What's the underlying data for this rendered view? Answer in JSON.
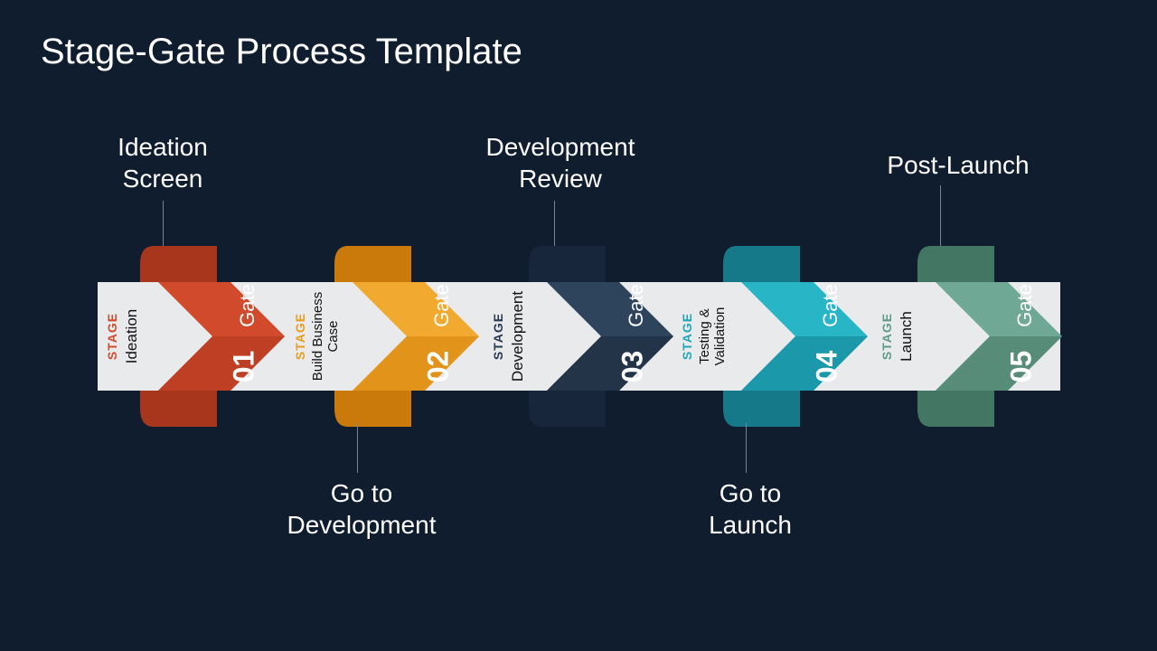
{
  "title": "Stage-Gate Process Template",
  "gate_word": "Gate",
  "stage_word": "STAGE",
  "stages": [
    {
      "name": "Ideation",
      "color": "#d24a2c",
      "dark": "#a8361c",
      "num": "01",
      "callout": "Ideation\nScreen",
      "callout_side": "top"
    },
    {
      "name": "Build Business\nCase",
      "color": "#eb9b1d",
      "dark": "#c97a0b",
      "num": "02",
      "callout": "Go to\nDevelopment",
      "callout_side": "bottom"
    },
    {
      "name": "Development",
      "color": "#27394f",
      "dark": "#17263a",
      "num": "03",
      "callout": "Development\nReview",
      "callout_side": "top"
    },
    {
      "name": "Testing &\nValidation",
      "color": "#1fa7b8",
      "dark": "#16798a",
      "num": "04",
      "callout": "Go to\nLaunch",
      "callout_side": "bottom"
    },
    {
      "name": "Launch",
      "color": "#5f9b86",
      "dark": "#447763",
      "num": "05",
      "callout": "Post-Launch",
      "callout_side": "top"
    }
  ]
}
